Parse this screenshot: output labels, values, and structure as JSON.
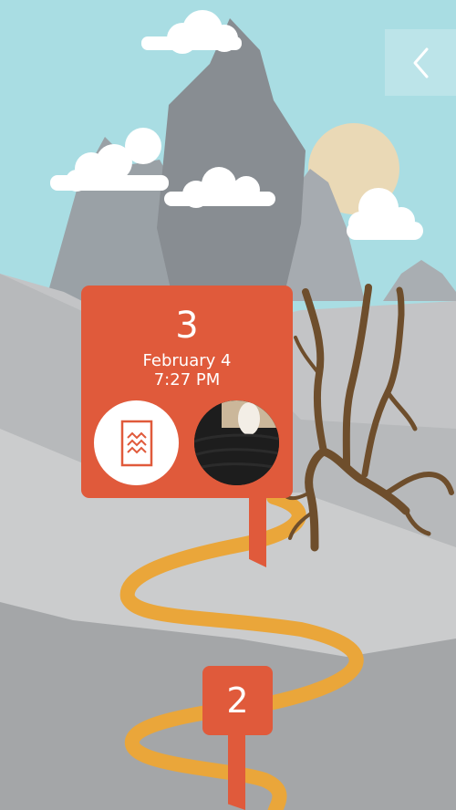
{
  "nav": {
    "back_icon": "chevron-left-icon"
  },
  "current_entry": {
    "number": "3",
    "date": "February 4",
    "time": "7:27 PM",
    "attachments": [
      {
        "type": "document",
        "icon": "document-icon"
      },
      {
        "type": "photo"
      }
    ]
  },
  "previous_entry": {
    "number": "2"
  },
  "colors": {
    "sky": "#a9dde3",
    "marker": "#e05a3b",
    "path": "#eaa63a",
    "tree": "#6e4e2c",
    "sun": "#ead9b6"
  }
}
